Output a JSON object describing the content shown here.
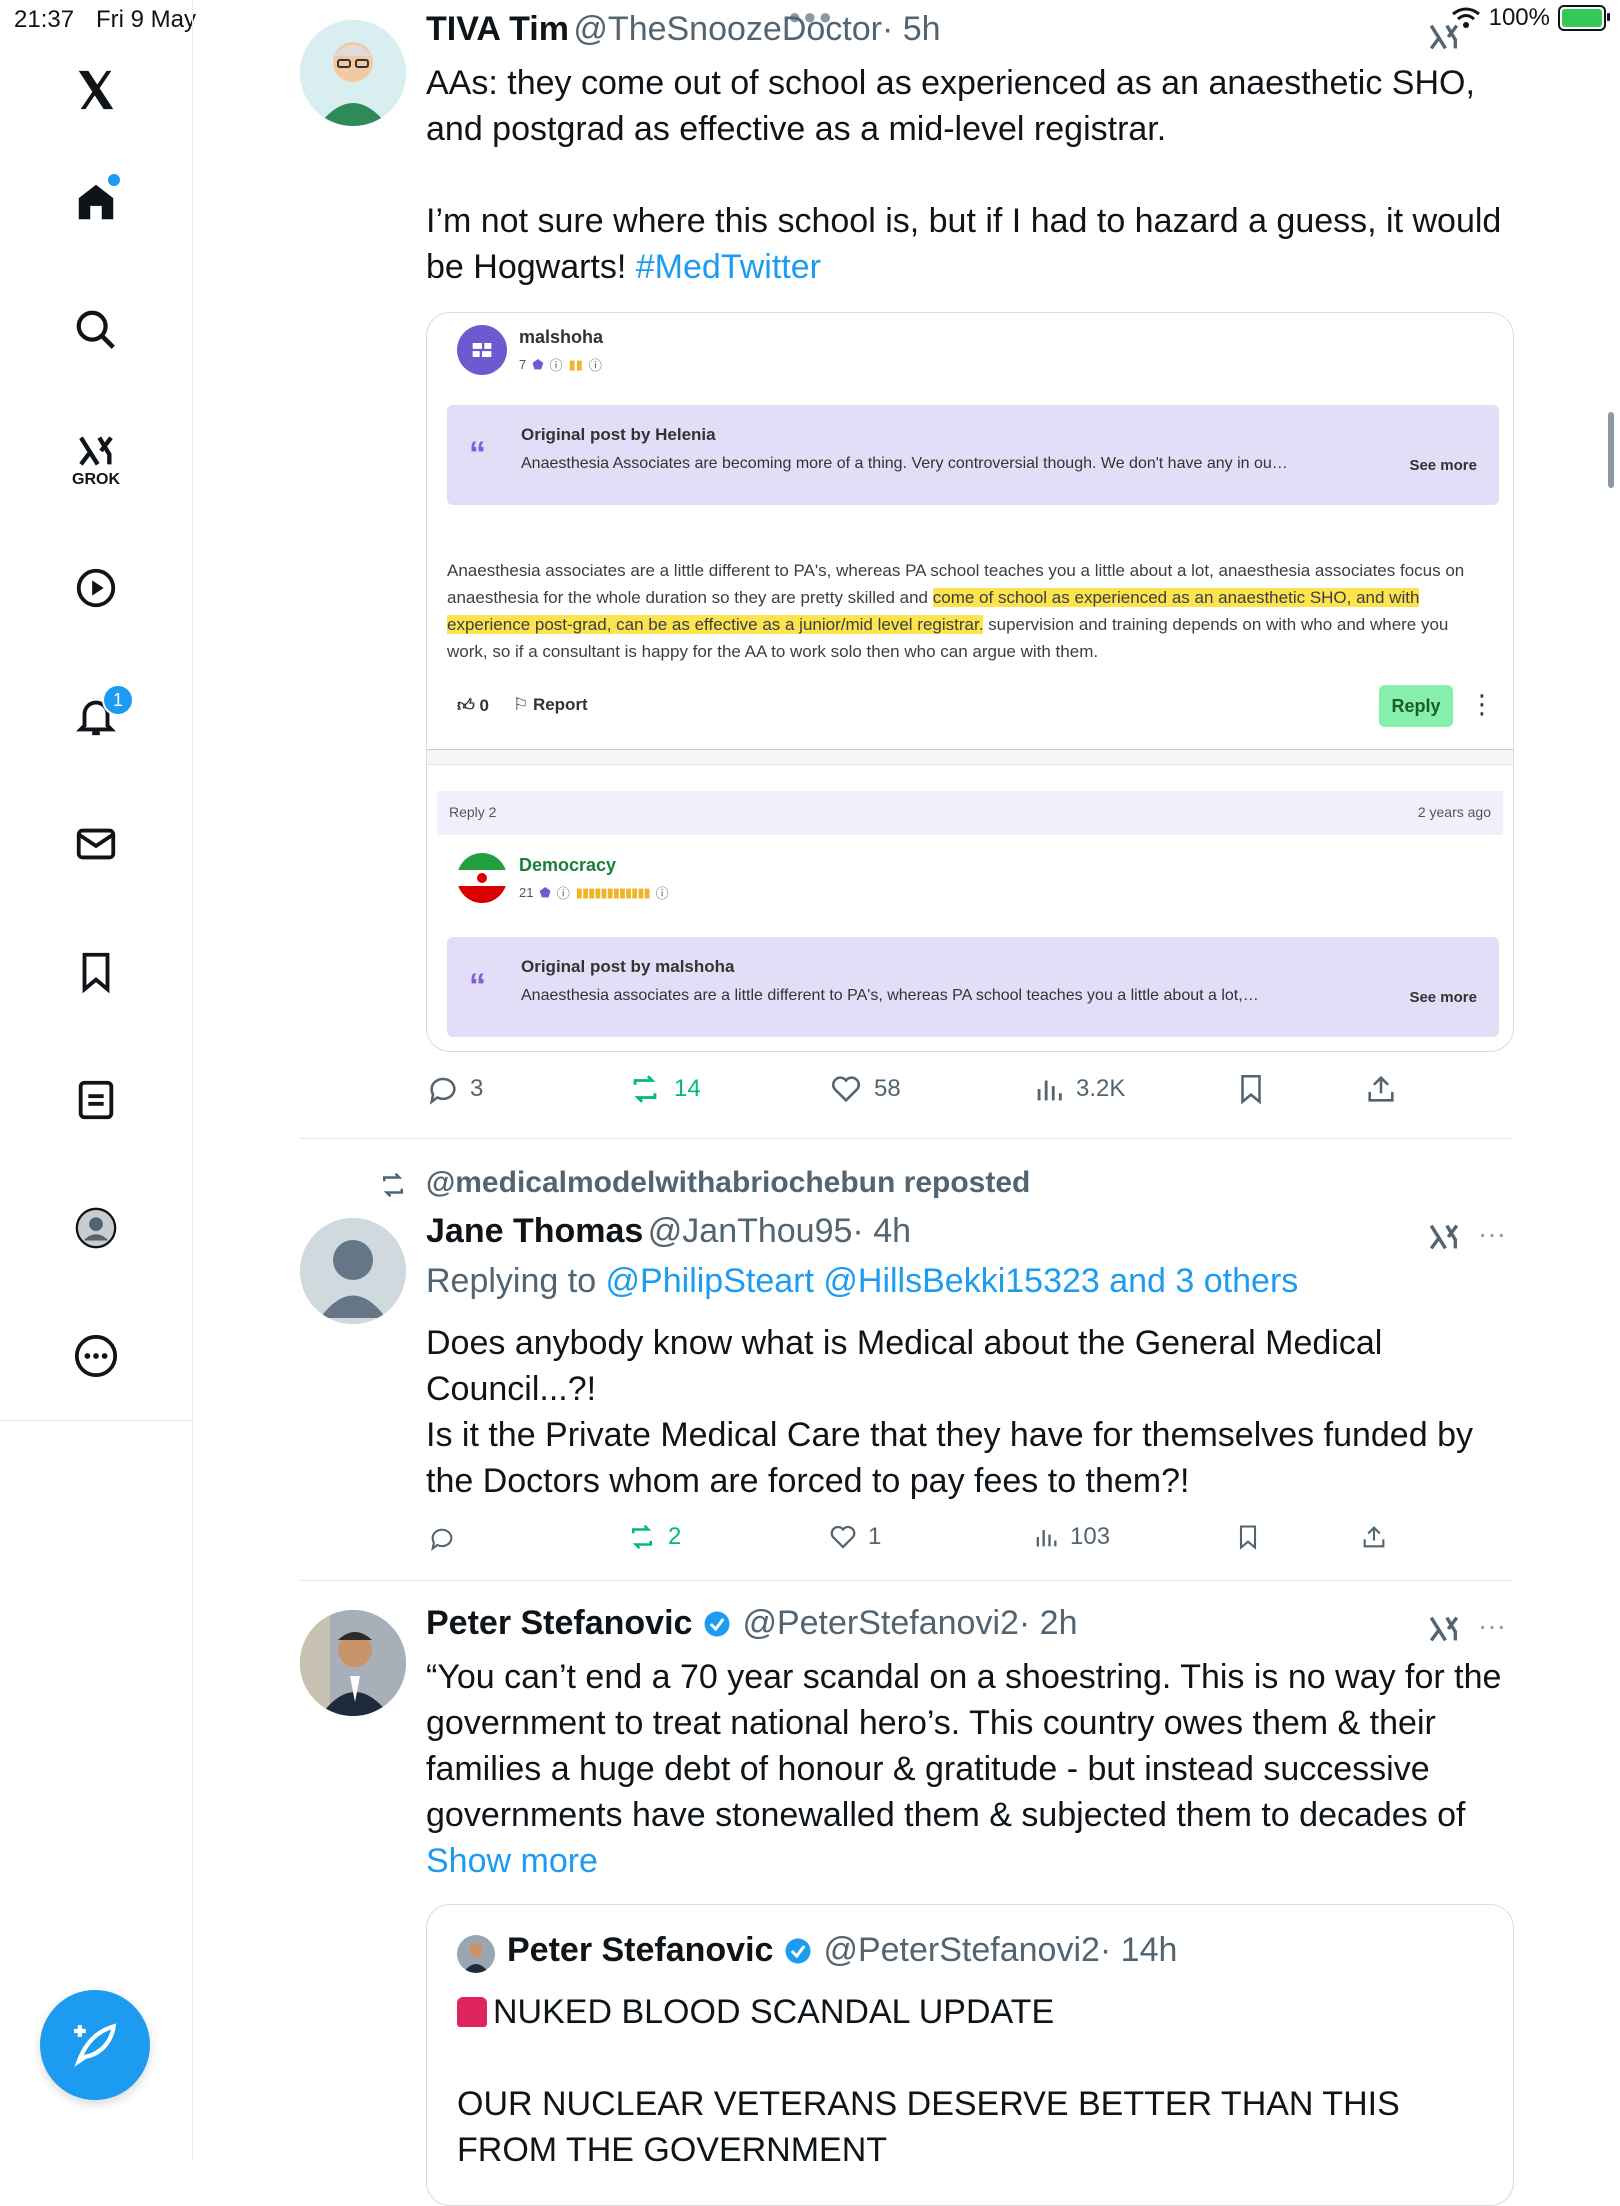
{
  "status": {
    "time": "21:37",
    "date": "Fri 9 May",
    "battery": "100%"
  },
  "sidebar": {
    "items": [
      {
        "name": "x-logo-icon"
      },
      {
        "name": "home-icon"
      },
      {
        "name": "search-icon"
      },
      {
        "name": "grok-icon",
        "label": "GROK"
      },
      {
        "name": "video-icon"
      },
      {
        "name": "notifications-icon",
        "badge": "1"
      },
      {
        "name": "messages-icon"
      },
      {
        "name": "bookmarks-icon"
      },
      {
        "name": "lists-icon"
      },
      {
        "name": "profile-icon"
      },
      {
        "name": "more-icon"
      }
    ]
  },
  "tweet1": {
    "name": "TIVA Tim",
    "handle": "@TheSnoozeDoctor",
    "time": "· 5h",
    "text1": "AAs: they come out of school as experienced as an anaesthetic SHO, and postgrad as effective as a mid-level registrar.",
    "text2": "I’m not sure where this school is, but if I had to hazard a guess, it would be Hogwarts! ",
    "hashtag": "#MedTwitter",
    "card": {
      "user": "malshoha",
      "stats": "7",
      "quote_title": "Original post by Helenia",
      "quote_text": "Anaesthesia Associates are becoming more of a thing. Very controversial though. We don't have any in ou…",
      "see_more": "See more",
      "para_a": "Anaesthesia associates are a little different to PA's, whereas PA school teaches you a little about a lot, anaesthesia associates focus on anaesthesia for the whole duration so they are pretty skilled and ",
      "para_hl1": "come of school as experienced as an anaesthetic SHO, and with experience post-grad, can be as effective as a junior/mid level registrar.",
      "para_b": " supervision and training depends on with who and where you work, so if a consultant is happy for the AA to work solo then who can argue with them.",
      "likes": "0",
      "report": "Report",
      "reply": "Reply",
      "reply2": "Reply 2",
      "ago": "2 years ago",
      "user2": "Democracy",
      "stats2": "21",
      "quote2_title": "Original post by malshoha",
      "quote2_text": "Anaesthesia associates are a little different to PA's, whereas PA school teaches you a little about a lot,…",
      "see_more2": "See more"
    },
    "replies": "3",
    "reposts": "14",
    "likes": "58",
    "views": "3.2K"
  },
  "tweet2": {
    "reposted_by": "@medicalmodelwithabriochebun reposted",
    "name": "Jane Thomas",
    "handle": "@JanThou95",
    "time": "· 4h",
    "replying_prefix": "Replying to ",
    "replying_to": "@PhilipSteart @HillsBekki15323 and 3 others",
    "text1": "Does anybody know what is Medical about the General Medical Council...?!",
    "text2": "Is it the Private Medical Care that they have for themselves funded by the Doctors whom are forced to pay fees to them?!",
    "reposts": "2",
    "likes": "1",
    "views": "103"
  },
  "tweet3": {
    "name": "Peter Stefanovic",
    "handle": "@PeterStefanovi2",
    "time": "· 2h",
    "text": "“You can’t end a 70 year scandal on a shoestring. This is no way for the government to treat national hero’s. This country owes them & their families a huge debt of honour & gratitude - but instead successive governments have stonewalled them & subjected them to decades of ",
    "show_more": "Show more",
    "quoted": {
      "name": "Peter Stefanovic",
      "handle": "@PeterStefanovi2",
      "time": "· 14h",
      "line1": "NUKED BLOOD SCANDAL UPDATE",
      "line2": "OUR NUCLEAR VETERANS DESERVE BETTER THAN THIS FROM THE GOVERNMENT"
    }
  }
}
